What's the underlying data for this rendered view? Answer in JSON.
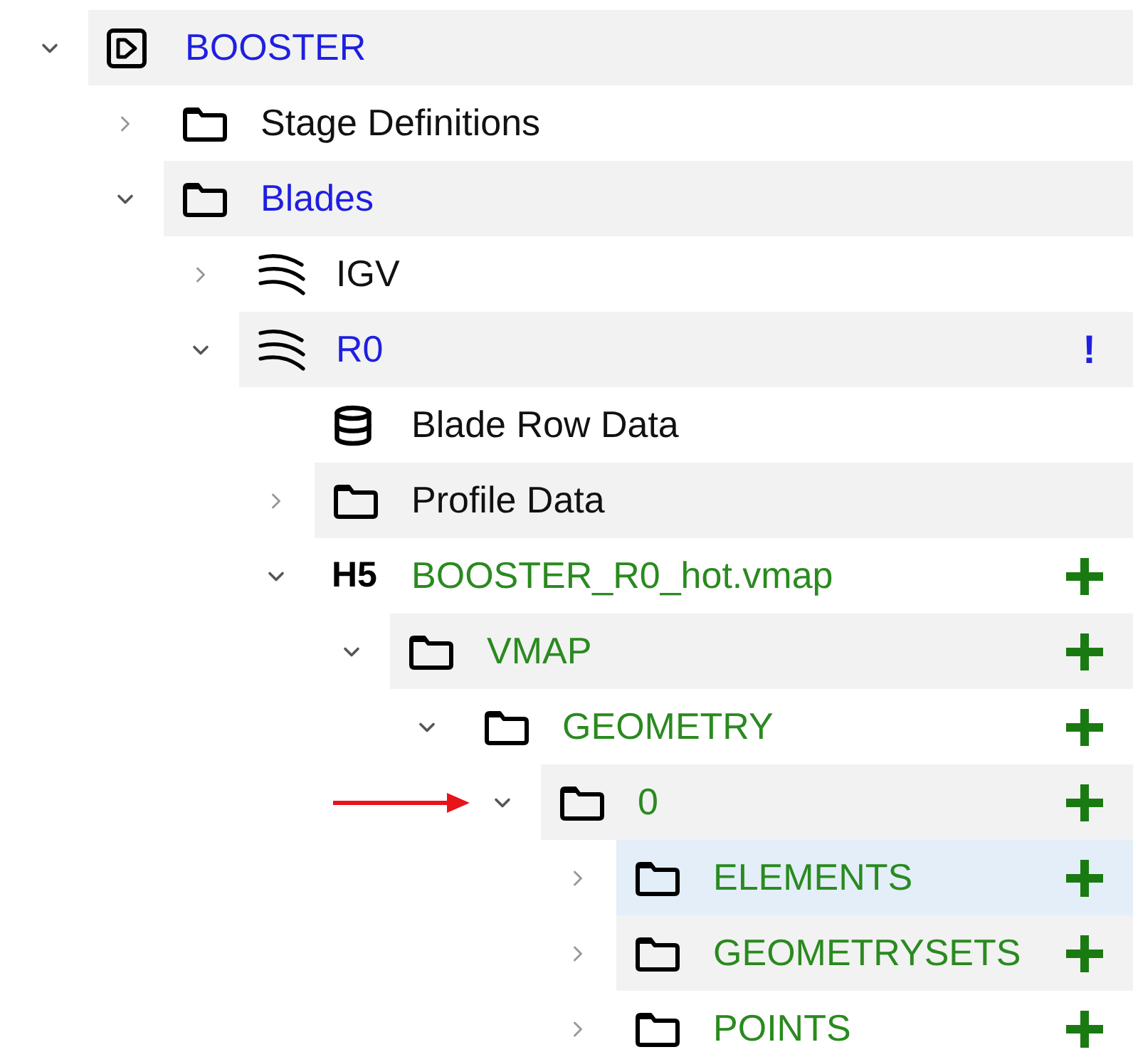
{
  "tree": [
    {
      "label": "BOOSTER",
      "kind": "project",
      "color": "#1f1fe0",
      "expanded": true,
      "selected": false,
      "children": [
        {
          "label": "Stage Definitions",
          "kind": "folder",
          "color": "#111111",
          "expanded": false,
          "selected": false
        },
        {
          "label": "Blades",
          "kind": "folder",
          "color": "#1f1fe0",
          "expanded": true,
          "selected": false,
          "children": [
            {
              "label": "IGV",
              "kind": "blade",
              "color": "#111111",
              "expanded": false,
              "selected": false
            },
            {
              "label": "R0",
              "kind": "blade",
              "color": "#1f1fe0",
              "expanded": true,
              "selected": false,
              "marker": "!",
              "children": [
                {
                  "label": "Blade Row Data",
                  "kind": "database",
                  "color": "#111111",
                  "selected": false
                },
                {
                  "label": "Profile Data",
                  "kind": "folder",
                  "color": "#111111",
                  "expanded": false,
                  "selected": false
                },
                {
                  "label": "BOOSTER_R0_hot.vmap",
                  "kind": "text",
                  "icon_text": "H5",
                  "color": "#2a8a1f",
                  "expanded": true,
                  "selected": false,
                  "added": true,
                  "children": [
                    {
                      "label": "VMAP",
                      "kind": "folder",
                      "color": "#2a8a1f",
                      "expanded": true,
                      "selected": false,
                      "added": true,
                      "children": [
                        {
                          "label": "GEOMETRY",
                          "kind": "folder",
                          "color": "#2a8a1f",
                          "expanded": true,
                          "selected": false,
                          "added": true,
                          "children": [
                            {
                              "label": "0",
                              "kind": "folder",
                              "color": "#2a8a1f",
                              "expanded": true,
                              "selected": false,
                              "added": true,
                              "pointer": true,
                              "children": [
                                {
                                  "label": "ELEMENTS",
                                  "kind": "folder",
                                  "color": "#2a8a1f",
                                  "expanded": false,
                                  "selected": true,
                                  "added": true
                                },
                                {
                                  "label": "GEOMETRYSETS",
                                  "kind": "folder",
                                  "color": "#2a8a1f",
                                  "expanded": false,
                                  "selected": false,
                                  "added": true
                                },
                                {
                                  "label": "POINTS",
                                  "kind": "folder",
                                  "color": "#2a8a1f",
                                  "expanded": false,
                                  "selected": false,
                                  "added": true
                                }
                              ]
                            }
                          ]
                        }
                      ]
                    }
                  ]
                }
              ]
            }
          ]
        }
      ]
    }
  ]
}
